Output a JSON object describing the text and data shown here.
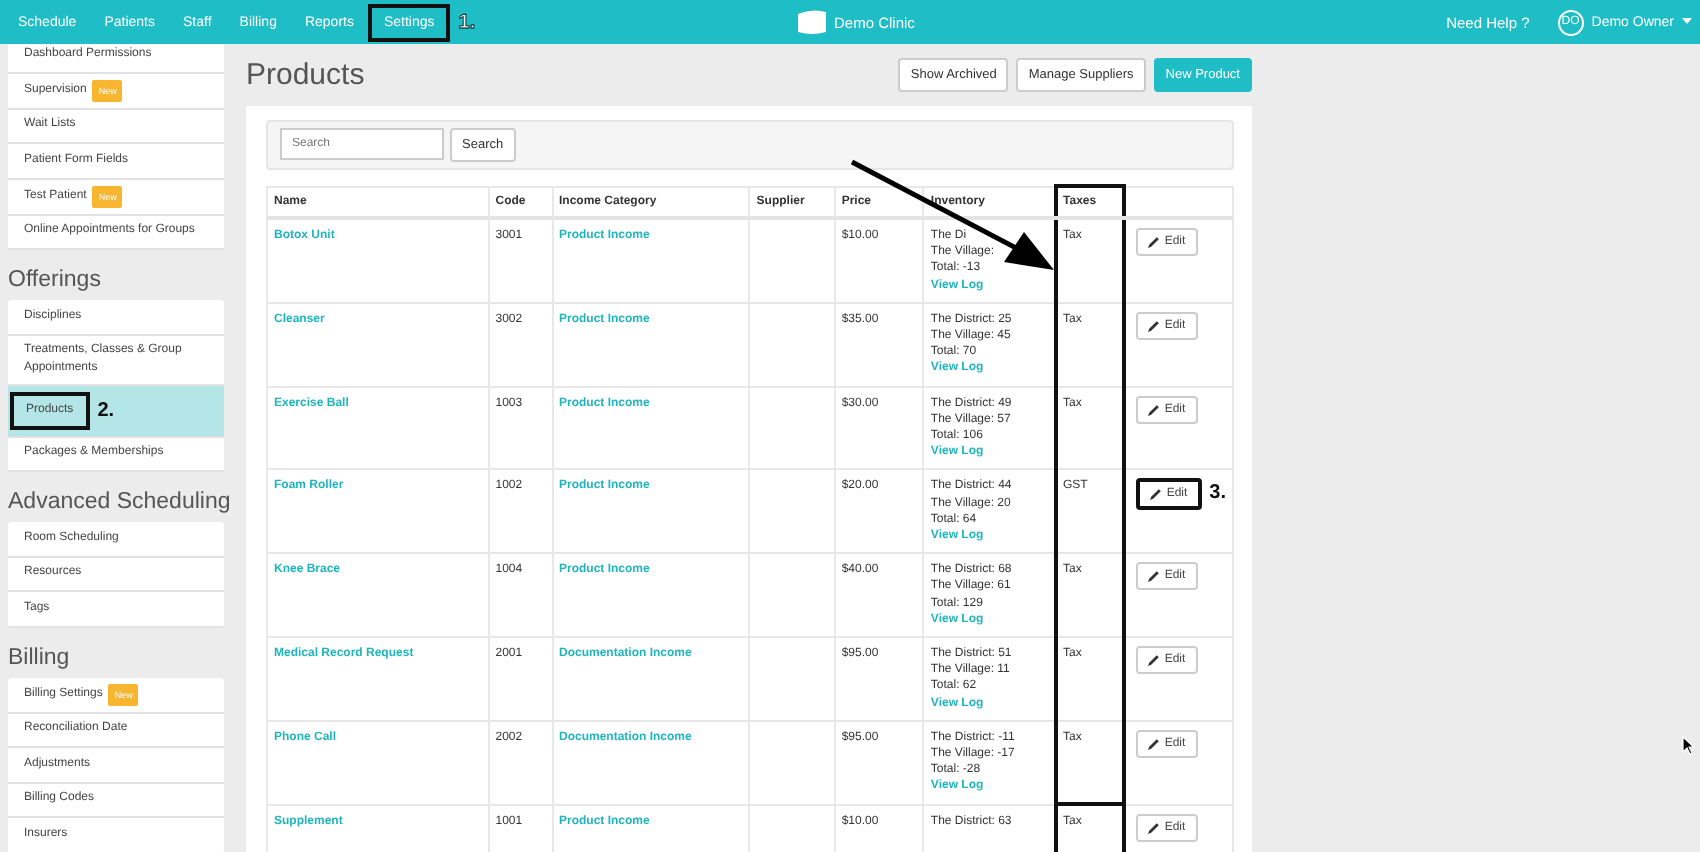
{
  "topbar": {
    "nav": [
      {
        "label": "Schedule"
      },
      {
        "label": "Patients"
      },
      {
        "label": "Staff"
      },
      {
        "label": "Billing"
      },
      {
        "label": "Reports"
      },
      {
        "label": "Settings",
        "annotation": "1."
      }
    ],
    "brand": "Demo Clinic",
    "help": "Need Help ?",
    "user": {
      "initials": "DO",
      "name": "Demo Owner"
    }
  },
  "sidebar": [
    {
      "items": [
        {
          "label": "Dashboard Permissions",
          "selected": false
        },
        {
          "label": "Supervision",
          "badge": "New",
          "selected": false
        },
        {
          "label": "Wait Lists",
          "selected": false
        },
        {
          "label": "Patient Form Fields",
          "selected": false
        },
        {
          "label": "Test Patient",
          "badge": "New",
          "selected": false
        },
        {
          "label": "Online Appointments for Groups",
          "selected": false
        }
      ]
    },
    {
      "title": "Offerings",
      "items": [
        {
          "label": "Disciplines",
          "selected": false
        },
        {
          "label": "Treatments, Classes & Group Appointments",
          "selected": false
        },
        {
          "label": "Products",
          "selected": true,
          "annotation": "2."
        },
        {
          "label": "Packages & Memberships",
          "selected": false
        }
      ]
    },
    {
      "title": "Advanced Scheduling",
      "items": [
        {
          "label": "Room Scheduling",
          "selected": false
        },
        {
          "label": "Resources",
          "selected": false
        },
        {
          "label": "Tags",
          "selected": false
        }
      ]
    },
    {
      "title": "Billing",
      "items": [
        {
          "label": "Billing Settings",
          "badge": "New",
          "selected": false
        },
        {
          "label": "Reconciliation Date",
          "selected": false
        },
        {
          "label": "Adjustments",
          "selected": false
        },
        {
          "label": "Billing Codes",
          "selected": false
        },
        {
          "label": "Insurers",
          "selected": false
        }
      ]
    }
  ],
  "page": {
    "title": "Products",
    "buttons": [
      {
        "label": "Show Archived",
        "primary": false
      },
      {
        "label": "Manage Suppliers",
        "primary": false
      },
      {
        "label": "New Product",
        "primary": true
      }
    ],
    "search": {
      "placeholder": "Search",
      "button": "Search"
    },
    "table": {
      "columns": [
        {
          "label": "Name",
          "outlined": false
        },
        {
          "label": "Code",
          "outlined": false
        },
        {
          "label": "Income Category",
          "outlined": false
        },
        {
          "label": "Supplier",
          "outlined": false
        },
        {
          "label": "Price",
          "outlined": false
        },
        {
          "label": "Inventory",
          "outlined": false
        },
        {
          "label": "Taxes",
          "outlined": true
        },
        {
          "outlined": false
        }
      ],
      "rows": [
        {
          "name": "Botox Unit",
          "code": "3001",
          "category": "Product Income",
          "price": "$10.00",
          "inventory": [
            "The Di",
            "The Village:",
            "Total: -13"
          ],
          "log": "View Log",
          "taxes": "Tax",
          "edit": "Edit"
        },
        {
          "name": "Cleanser",
          "code": "3002",
          "category": "Product Income",
          "price": "$35.00",
          "inventory": [
            "The District: 25",
            "The Village: 45",
            "Total: 70"
          ],
          "log": "View Log",
          "taxes": "Tax",
          "edit": "Edit"
        },
        {
          "name": "Exercise Ball",
          "code": "1003",
          "category": "Product Income",
          "price": "$30.00",
          "inventory": [
            "The District: 49",
            "The Village: 57",
            "Total: 106"
          ],
          "log": "View Log",
          "taxes": "Tax",
          "edit": "Edit"
        },
        {
          "name": "Foam Roller",
          "code": "1002",
          "category": "Product Income",
          "price": "$20.00",
          "inventory": [
            "The District: 44",
            "The Village: 20",
            "Total: 64"
          ],
          "log": "View Log",
          "taxes": "GST",
          "edit": "Edit",
          "annotation": "3."
        },
        {
          "name": "Knee Brace",
          "code": "1004",
          "category": "Product Income",
          "price": "$40.00",
          "inventory": [
            "The District: 68",
            "The Village: 61",
            "Total: 129"
          ],
          "log": "View Log",
          "taxes": "Tax",
          "edit": "Edit"
        },
        {
          "name": "Medical Record Request",
          "code": "2001",
          "category": "Documentation Income",
          "price": "$95.00",
          "inventory": [
            "The District: 51",
            "The Village: 11",
            "Total: 62"
          ],
          "log": "View Log",
          "taxes": "Tax",
          "edit": "Edit"
        },
        {
          "name": "Phone Call",
          "code": "2002",
          "category": "Documentation Income",
          "price": "$95.00",
          "inventory": [
            "The District: -11",
            "The Village: -17",
            "Total: -28"
          ],
          "log": "View Log",
          "taxes": "Tax",
          "edit": "Edit"
        },
        {
          "name": "Supplement",
          "code": "1001",
          "category": "Product Income",
          "price": "$10.00",
          "inventory": [
            "The District: 63"
          ],
          "taxes": "Tax",
          "edit": "Edit"
        }
      ]
    }
  }
}
